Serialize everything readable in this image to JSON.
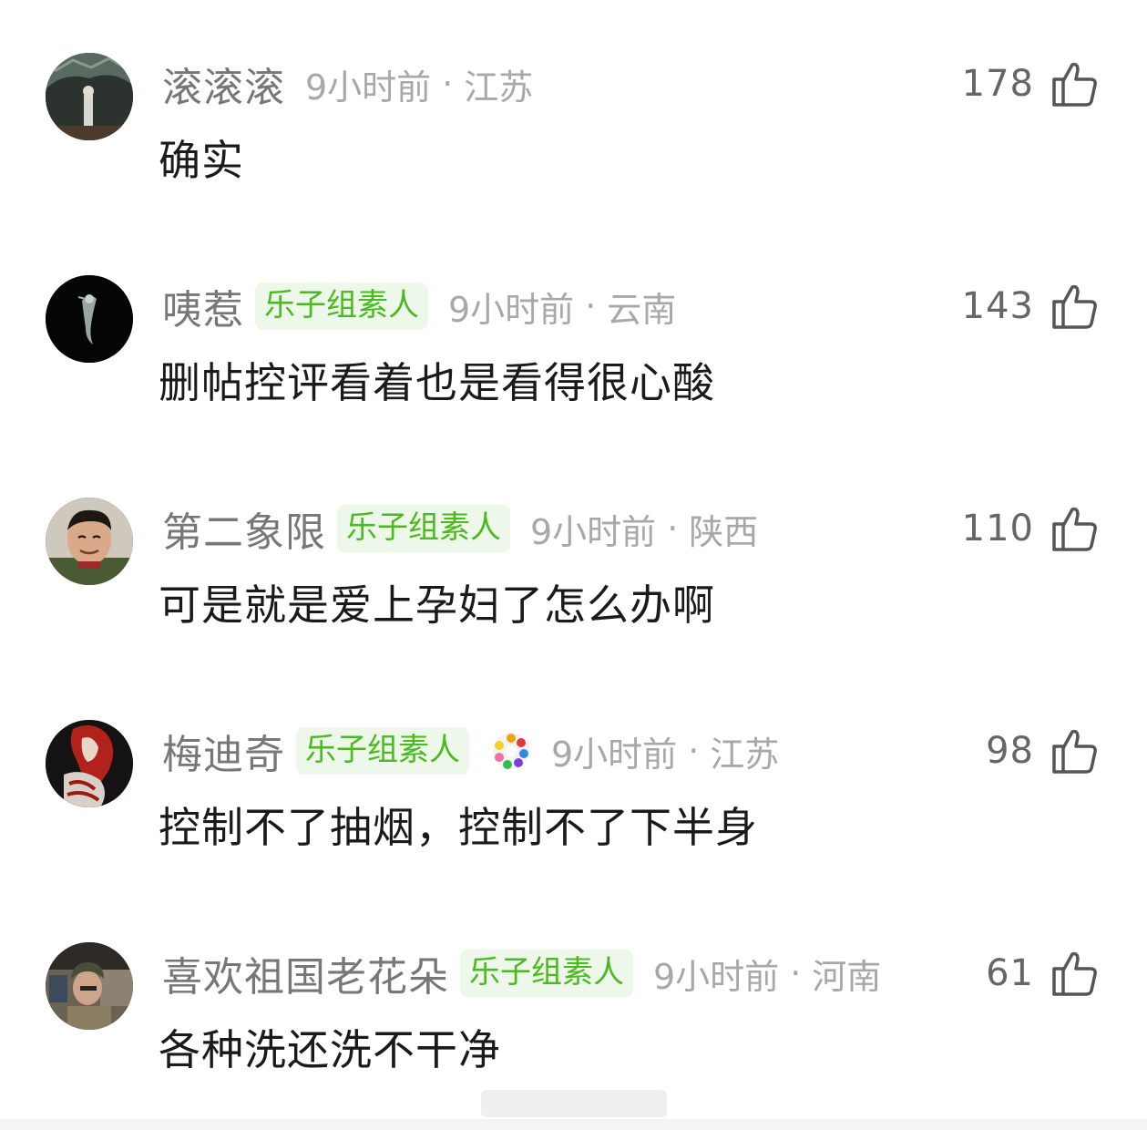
{
  "comments": [
    {
      "username": "滚滚滚",
      "badge": "",
      "time": "9小时前",
      "dot": "·",
      "region": "江苏",
      "likes": "178",
      "content": "确实"
    },
    {
      "username": "咦惹",
      "badge": "乐子组素人",
      "time": "9小时前",
      "dot": "·",
      "region": "云南",
      "likes": "143",
      "content": "删帖控评看着也是看得很心酸"
    },
    {
      "username": "第二象限",
      "badge": "乐子组素人",
      "time": "9小时前",
      "dot": "·",
      "region": "陕西",
      "likes": "110",
      "content": "可是就是爱上孕妇了怎么办啊"
    },
    {
      "username": "梅迪奇",
      "badge": "乐子组素人",
      "time": "9小时前",
      "dot": "·",
      "region": "江苏",
      "likes": "98",
      "content": "控制不了抽烟，控制不了下半身"
    },
    {
      "username": "喜欢祖国老花朵",
      "badge": "乐子组素人",
      "time": "9小时前",
      "dot": "·",
      "region": "河南",
      "likes": "61",
      "content": "各种洗还洗不干净"
    }
  ],
  "icons": {
    "like": "thumbs-up-icon",
    "medal": "colorful-medal-icon"
  },
  "colors": {
    "badge_text": "#4aba1f",
    "badge_bg": "#eef8ea",
    "meta_gray": "#a8a8a8",
    "username_gray": "#777777"
  }
}
